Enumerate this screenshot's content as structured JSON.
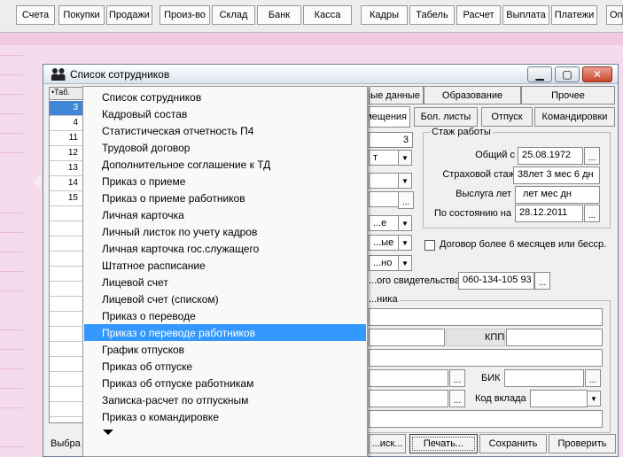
{
  "toolbar": {
    "buttons": [
      "Счета",
      "Покупки",
      "Продажи",
      "Произ-во",
      "Склад",
      "Банк",
      "Касса",
      "Кадры",
      "Табель",
      "Расчет",
      "Выплата",
      "Платежи",
      "Оп"
    ]
  },
  "window": {
    "title": "Список сотрудников",
    "minimize": "▁",
    "maximize": "▢",
    "close": "✕"
  },
  "grid": {
    "header": "•Таб.",
    "rows": [
      "3",
      "4",
      "11",
      "12",
      "13",
      "14",
      "15",
      "",
      "",
      "",
      "",
      "",
      "",
      "",
      "",
      "",
      "",
      "",
      "",
      "",
      ""
    ],
    "selected_index": 0
  },
  "tabs": {
    "row1": [
      "...вые данные",
      "Образование",
      "Прочее"
    ],
    "row2": [
      "...мещения",
      "Бол. листы",
      "Отпуск",
      "Командировки"
    ]
  },
  "form": {
    "top_value": "3",
    "partial_fields": [
      "...е",
      "...ые",
      "...но"
    ],
    "stazh_title": "Стаж работы",
    "obshchiy_label": "Общий с",
    "obshchiy_value": "25.08.1972",
    "strakh_label": "Страховой стаж",
    "strakh_value": "38лет 3 мес 6 дн",
    "vysluga_label": "Выслуга лет",
    "vysluga_value": "лет  мес  дн",
    "po_sost_label": "По состоянию на",
    "po_sost_value": "28.12.2011",
    "dogovor_label": "Договор более 6 месяцев или бесср.",
    "svid_label": "...ого свидетельства",
    "svid_value": "060-134-105 93",
    "bank_group_title": "...ника",
    "kpp_label": "КПП",
    "bik_label": "БИК",
    "kod_vklada_label": "Код вклада"
  },
  "bottom": {
    "left_label": "Выбра",
    "btn_search": "...иск...",
    "btn_print": "Печать...",
    "btn_save": "Сохранить",
    "btn_check": "Проверить"
  },
  "menu": {
    "items": [
      "Список сотрудников",
      "Кадровый состав",
      "Статистическая отчетность П4",
      "Трудовой договор",
      "Дополнительное соглашение к ТД",
      "Приказ о приеме",
      "Приказ о приеме работников",
      "Личная карточка",
      "Личный листок по учету кадров",
      "Личная карточка гос.служащего",
      "Штатное расписание",
      "Лицевой счет",
      "Лицевой счет (списком)",
      "Приказ о переводе",
      "Приказ о переводе работников",
      "График отпусков",
      "Приказ об отпуске",
      "Приказ об отпуске работникам",
      "Записка-расчет по отпускным",
      "Приказ о командировке"
    ],
    "highlighted_index": 14
  },
  "colors": {
    "desktop": "#f5dcec",
    "menu_highlight": "#3399ff",
    "grid_selection": "#3f86d7"
  }
}
